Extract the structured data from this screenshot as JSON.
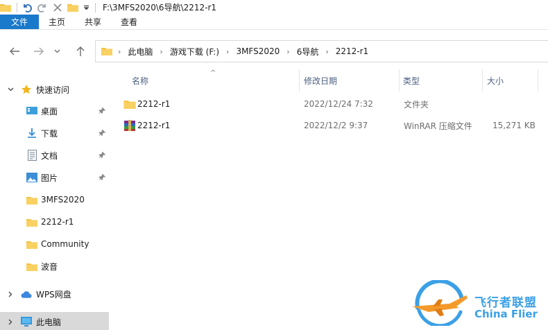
{
  "title": {
    "path": "F:\\3MFS2020\\6导航\\2212-r1"
  },
  "ribbon": {
    "tabs": [
      "文件",
      "主页",
      "共享",
      "查看"
    ]
  },
  "address": {
    "crumbs": [
      "此电脑",
      "游戏下载 (F:)",
      "3MFS2020",
      "6导航",
      "2212-r1"
    ]
  },
  "sidebar": {
    "quick_access": "快速访问",
    "items": [
      {
        "label": "桌面",
        "icon": "desktop-icon",
        "pinned": true
      },
      {
        "label": "下载",
        "icon": "download-icon",
        "pinned": true
      },
      {
        "label": "文档",
        "icon": "document-icon",
        "pinned": true
      },
      {
        "label": "图片",
        "icon": "picture-icon",
        "pinned": true
      },
      {
        "label": "3MFS2020",
        "icon": "folder-icon",
        "pinned": false
      },
      {
        "label": "2212-r1",
        "icon": "folder-icon",
        "pinned": false
      },
      {
        "label": "Community",
        "icon": "folder-icon",
        "pinned": false
      },
      {
        "label": "波音",
        "icon": "folder-icon",
        "pinned": false
      }
    ],
    "wps": "WPS网盘",
    "this_pc": "此电脑"
  },
  "columns": {
    "name": "名称",
    "date": "修改日期",
    "type": "类型",
    "size": "大小"
  },
  "files": [
    {
      "name": "2212-r1",
      "date": "2022/12/24 7:32",
      "type": "文件夹",
      "size": "",
      "icon": "folder-icon"
    },
    {
      "name": "2212-r1",
      "date": "2022/12/2 9:37",
      "type": "WinRAR 压缩文件",
      "size": "15,271 KB",
      "icon": "winrar-archive-icon"
    }
  ],
  "watermark": {
    "cn": "飞行者联盟",
    "en": "China Flier"
  },
  "colors": {
    "accent": "#1979ca",
    "folder": "#f5c242",
    "header_text": "#4d6082",
    "watermark": "#3ba0e6"
  }
}
